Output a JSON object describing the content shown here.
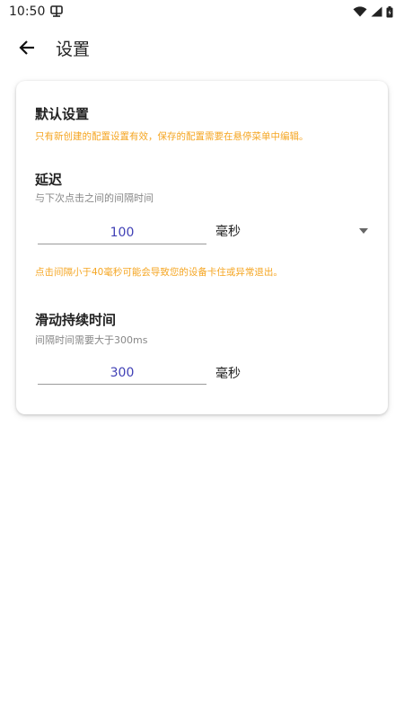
{
  "status_bar": {
    "time": "10:50",
    "notification_icon": "app-notification-icon",
    "icons": [
      "wifi-icon",
      "signal-icon",
      "battery-icon"
    ]
  },
  "app_bar": {
    "back_icon": "arrow-back-icon",
    "title": "设置"
  },
  "card": {
    "default_settings": {
      "title": "默认设置",
      "note": "只有新创建的配置设置有效，保存的配置需要在悬停菜单中编辑。"
    },
    "delay": {
      "title": "延迟",
      "description": "与下次点击之间的间隔时间",
      "value": "100",
      "unit_selected": "毫秒",
      "warning": "点击间隔小于40毫秒可能会导致您的设备卡住或异常退出。"
    },
    "swipe_duration": {
      "title": "滑动持续时间",
      "description": "间隔时间需要大于300ms",
      "value": "300",
      "unit": "毫秒"
    }
  },
  "colors": {
    "accent_text": "#3f3fb5",
    "warning_text": "#f5a623",
    "secondary_text": "#888888"
  }
}
